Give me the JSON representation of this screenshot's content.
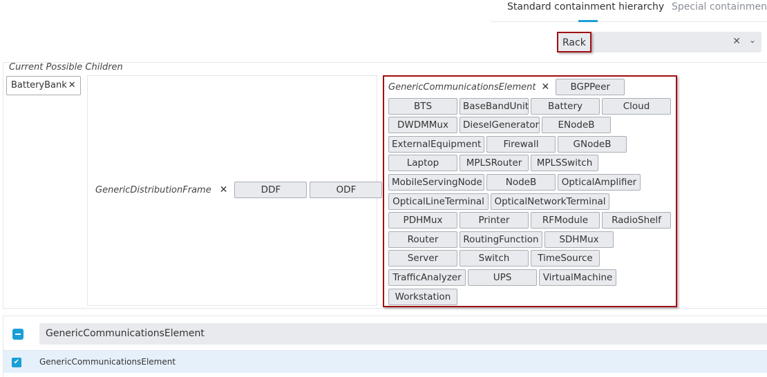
{
  "tabs": [
    {
      "label": "Standard containment hierarchy",
      "active": true
    },
    {
      "label": "Special containment",
      "active": false
    }
  ],
  "class_selector": {
    "selected": "Rack",
    "clear_icon": "close-icon",
    "dropdown_icon": "chevron-down-icon"
  },
  "section": {
    "title": "Current Possible Children",
    "direct_children": [
      "BatteryBank"
    ],
    "groups": [
      {
        "name": "GenericDistributionFrame",
        "children": [
          "DDF",
          "ODF"
        ]
      },
      {
        "name": "GenericCommunicationsElement",
        "children": [
          "BGPPeer",
          "BTS",
          "BaseBandUnit",
          "Battery",
          "Cloud",
          "DWDMMux",
          "DieselGenerator",
          "ENodeB",
          "ExternalEquipment",
          "Firewall",
          "GNodeB",
          "Laptop",
          "MPLSRouter",
          "MPLSSwitch",
          "MobileServingNode",
          "NodeB",
          "OpticalAmplifier",
          "OpticalLineTerminal",
          "OpticalNetworkTerminal",
          "PDHMux",
          "Printer",
          "RFModule",
          "RadioShelf",
          "Router",
          "RoutingFunction",
          "SDHMux",
          "Server",
          "Switch",
          "TimeSource",
          "TrafficAnalyzer",
          "UPS",
          "VirtualMachine",
          "Workstation"
        ]
      }
    ]
  },
  "tree": {
    "root": {
      "label": "GenericCommunicationsElement",
      "state": "indeterminate"
    },
    "items": [
      {
        "label": "GenericCommunicationsElement",
        "checked": true
      }
    ]
  },
  "colors": {
    "accent": "#1a9fd6",
    "highlight_border": "#a00d12"
  }
}
